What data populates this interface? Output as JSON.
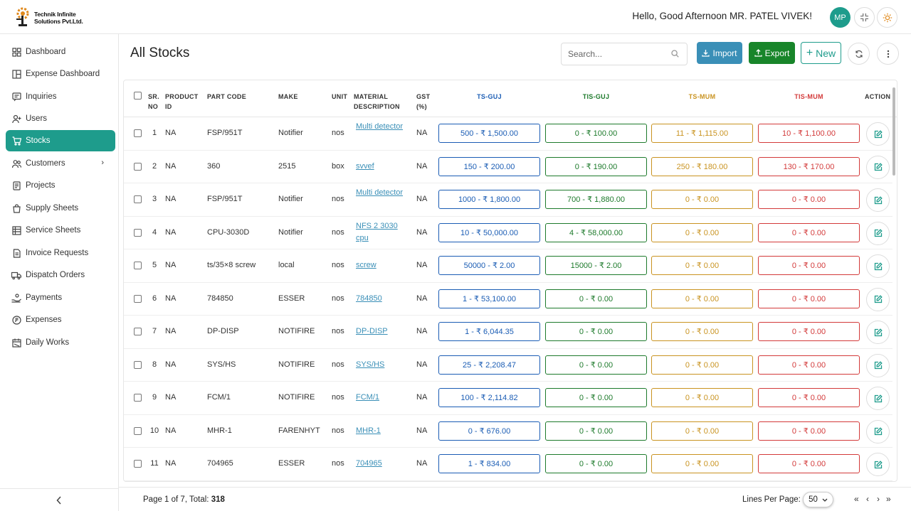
{
  "brand": {
    "name_line1": "Technik Infinite",
    "name_line2": "Solutions Pvt.Ltd."
  },
  "header": {
    "greeting": "Hello, Good Afternoon MR. PATEL VIVEK!",
    "avatar_initials": "MP"
  },
  "sidebar": {
    "items": [
      {
        "label": "Dashboard",
        "icon": "grid-icon"
      },
      {
        "label": "Expense Dashboard",
        "icon": "layout-icon"
      },
      {
        "label": "Inquiries",
        "icon": "message-icon"
      },
      {
        "label": "Users",
        "icon": "user-add-icon"
      },
      {
        "label": "Stocks",
        "icon": "cart-icon",
        "active": true
      },
      {
        "label": "Customers",
        "icon": "users-icon",
        "has_submenu": true
      },
      {
        "label": "Projects",
        "icon": "document-icon"
      },
      {
        "label": "Supply Sheets",
        "icon": "bag-icon"
      },
      {
        "label": "Service Sheets",
        "icon": "sheet-icon"
      },
      {
        "label": "Invoice Requests",
        "icon": "invoice-icon"
      },
      {
        "label": "Dispatch Orders",
        "icon": "truck-icon"
      },
      {
        "label": "Payments",
        "icon": "hand-coin-icon"
      },
      {
        "label": "Expenses",
        "icon": "coin-icon"
      },
      {
        "label": "Daily Works",
        "icon": "calendar-icon"
      }
    ]
  },
  "main": {
    "title": "All Stocks",
    "search_placeholder": "Search...",
    "import_label": "Import",
    "export_label": "Export",
    "new_label": "New"
  },
  "table": {
    "headers": {
      "sr_no_1": "SR.",
      "sr_no_2": "NO",
      "product_id_1": "PRODUCT",
      "product_id_2": "ID",
      "part_code": "PART CODE",
      "make": "MAKE",
      "unit": "UNIT",
      "material_1": "MATERIAL",
      "material_2": "DESCRIPTION",
      "gst_1": "GST",
      "gst_2": "(%)",
      "ts_guj": "TS-GUJ",
      "tis_guj": "TIS-GUJ",
      "ts_mum": "TS-MUM",
      "tis_mum": "TIS-MUM",
      "action": "ACTION"
    },
    "header_colors": {
      "ts_guj": "#1a5cb4",
      "tis_guj": "#1d7a2b",
      "ts_mum": "#c99320",
      "tis_mum": "#d33a3a"
    },
    "rows": [
      {
        "sr": "1",
        "product_id": "NA",
        "part_code": "FSP/951T",
        "make": "Notifier",
        "unit": "nos",
        "material": "Multi detector",
        "gst": "NA",
        "ts_guj": "500 - ₹ 1,500.00",
        "tis_guj": "0 - ₹ 100.00",
        "ts_mum": "11 - ₹ 1,115.00",
        "tis_mum": "10 - ₹ 1,100.00"
      },
      {
        "sr": "2",
        "product_id": "NA",
        "part_code": "360",
        "make": "2515",
        "unit": "box",
        "material": "svvef",
        "gst": "NA",
        "ts_guj": "150 - ₹ 200.00",
        "tis_guj": "0 - ₹ 190.00",
        "ts_mum": "250 - ₹ 180.00",
        "tis_mum": "130 - ₹ 170.00"
      },
      {
        "sr": "3",
        "product_id": "NA",
        "part_code": "FSP/951T",
        "make": "Notifier",
        "unit": "nos",
        "material": "Multi detector",
        "gst": "NA",
        "ts_guj": "1000 - ₹ 1,800.00",
        "tis_guj": "700 - ₹ 1,880.00",
        "ts_mum": "0 - ₹ 0.00",
        "tis_mum": "0 - ₹ 0.00"
      },
      {
        "sr": "4",
        "product_id": "NA",
        "part_code": "CPU-3030D",
        "make": "Notifier",
        "unit": "nos",
        "material": "NFS 2 3030 cpu",
        "gst": "NA",
        "ts_guj": "10 - ₹ 50,000.00",
        "tis_guj": "4 - ₹ 58,000.00",
        "ts_mum": "0 - ₹ 0.00",
        "tis_mum": "0 - ₹ 0.00"
      },
      {
        "sr": "5",
        "product_id": "NA",
        "part_code": "ts/35×8 screw",
        "make": "local",
        "unit": "nos",
        "material": "screw",
        "gst": "NA",
        "ts_guj": "50000 - ₹ 2.00",
        "tis_guj": "15000 - ₹ 2.00",
        "ts_mum": "0 - ₹ 0.00",
        "tis_mum": "0 - ₹ 0.00"
      },
      {
        "sr": "6",
        "product_id": "NA",
        "part_code": "784850",
        "make": "ESSER",
        "unit": "nos",
        "material": "784850",
        "gst": "NA",
        "ts_guj": "1 - ₹ 53,100.00",
        "tis_guj": "0 - ₹ 0.00",
        "ts_mum": "0 - ₹ 0.00",
        "tis_mum": "0 - ₹ 0.00"
      },
      {
        "sr": "7",
        "product_id": "NA",
        "part_code": "DP-DISP",
        "make": "NOTIFIRE",
        "unit": "nos",
        "material": "DP-DISP",
        "gst": "NA",
        "ts_guj": "1 - ₹ 6,044.35",
        "tis_guj": "0 - ₹ 0.00",
        "ts_mum": "0 - ₹ 0.00",
        "tis_mum": "0 - ₹ 0.00"
      },
      {
        "sr": "8",
        "product_id": "NA",
        "part_code": "SYS/HS",
        "make": "NOTIFIRE",
        "unit": "nos",
        "material": "SYS/HS",
        "gst": "NA",
        "ts_guj": "25 - ₹ 2,208.47",
        "tis_guj": "0 - ₹ 0.00",
        "ts_mum": "0 - ₹ 0.00",
        "tis_mum": "0 - ₹ 0.00"
      },
      {
        "sr": "9",
        "product_id": "NA",
        "part_code": "FCM/1",
        "make": "NOTIFIRE",
        "unit": "nos",
        "material": "FCM/1",
        "gst": "NA",
        "ts_guj": "100 - ₹ 2,114.82",
        "tis_guj": "0 - ₹ 0.00",
        "ts_mum": "0 - ₹ 0.00",
        "tis_mum": "0 - ₹ 0.00"
      },
      {
        "sr": "10",
        "product_id": "NA",
        "part_code": "MHR-1",
        "make": "FARENHYT",
        "unit": "nos",
        "material": "MHR-1",
        "gst": "NA",
        "ts_guj": "0 - ₹ 676.00",
        "tis_guj": "0 - ₹ 0.00",
        "ts_mum": "0 - ₹ 0.00",
        "tis_mum": "0 - ₹ 0.00"
      },
      {
        "sr": "11",
        "product_id": "NA",
        "part_code": "704965",
        "make": "ESSER",
        "unit": "nos",
        "material": "704965",
        "gst": "NA",
        "ts_guj": "1 - ₹ 834.00",
        "tis_guj": "0 - ₹ 0.00",
        "ts_mum": "0 - ₹ 0.00",
        "tis_mum": "0 - ₹ 0.00"
      }
    ]
  },
  "footer": {
    "page_text": "Page 1 of 7, Total: ",
    "total": "318",
    "lines_per_page_label": "Lines Per Page:",
    "lines_per_page_value": "50",
    "first": "«",
    "prev": "‹",
    "next": "›",
    "last": "»"
  },
  "colors": {
    "accent": "#1e9c8c",
    "import": "#3a8fb7",
    "export": "#18852a"
  }
}
